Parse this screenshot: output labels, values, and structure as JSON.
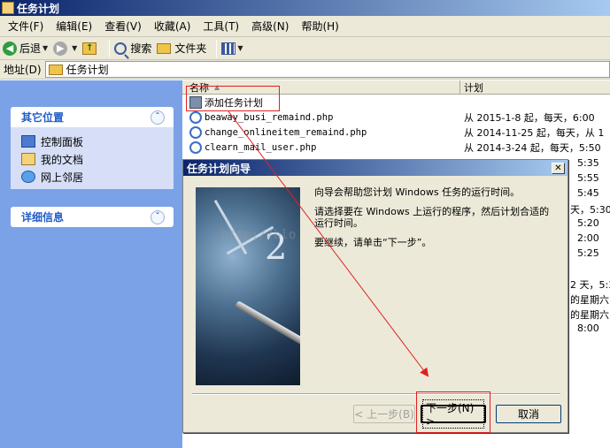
{
  "window": {
    "title": "任务计划"
  },
  "menu": [
    "文件(F)",
    "编辑(E)",
    "查看(V)",
    "收藏(A)",
    "工具(T)",
    "高级(N)",
    "帮助(H)"
  ],
  "toolbar": {
    "back": "后退",
    "search": "搜索",
    "folders": "文件夹"
  },
  "address": {
    "label": "地址(D)",
    "value": "任务计划"
  },
  "left_pane": {
    "other_places": {
      "title": "其它位置",
      "links": [
        "控制面板",
        "我的文档",
        "网上邻居"
      ]
    },
    "details": {
      "title": "详细信息"
    }
  },
  "columns": {
    "name": "名称",
    "schedule": "计划"
  },
  "rows": [
    {
      "name": "添加任务计划",
      "schedule": ""
    },
    {
      "name": "beaway_busi_remaind.php",
      "schedule": "从 2015-1-8 起，每天，6:00"
    },
    {
      "name": "change_onlineitem_remaind.php",
      "schedule": "从 2014-11-25 起，每天，从 1"
    },
    {
      "name": "clearn_mail_user.php",
      "schedule": "从 2014-3-24 起，每天，5:50"
    }
  ],
  "schedule_tails": [
    "5:35",
    "5:55",
    "5:45",
    "天，5:30",
    "5:20",
    "2:00",
    "5:25",
    "2 天，5:3",
    "的星期六",
    "的星期六",
    "8:00"
  ],
  "dialog": {
    "title": "任务计划向导",
    "para1": "向导会帮助您计划 Windows 任务的运行时间。",
    "para2": "请选择要在 Windows 上运行的程序，然后计划合适的运行时间。",
    "para3": "要继续，请单击“下一步”。",
    "back_button": "< 上一步(B)",
    "next_button": "下一步(N) >",
    "cancel_button": "取消"
  },
  "watermark": "http://blo",
  "colors": {
    "annotation": "#e02020",
    "title_gradient_start": "#0a246a",
    "taskpane_blue": "#7ba2e7"
  }
}
